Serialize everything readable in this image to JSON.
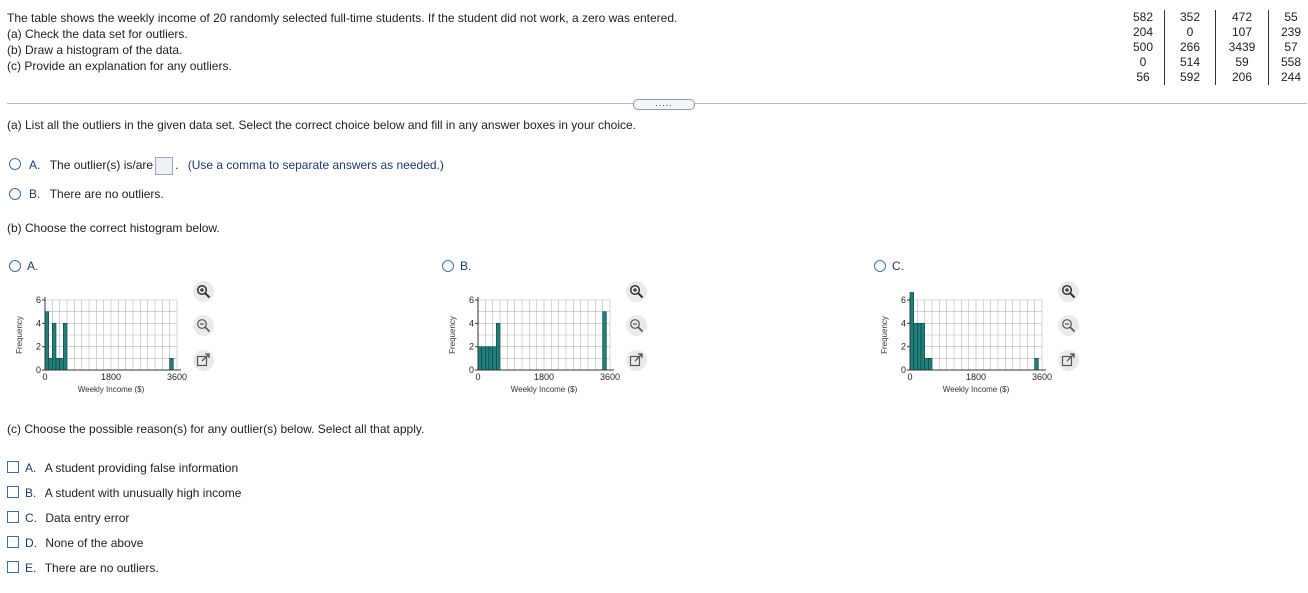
{
  "intro": {
    "line1": "The table shows the weekly income of 20 randomly selected full-time students. If the student did not work, a zero was entered.",
    "line2": "(a) Check the data set for outliers.",
    "line3": "(b) Draw a histogram of the data.",
    "line4": "(c) Provide an explanation for any outliers."
  },
  "data_table": {
    "rows": [
      [
        "582",
        "352",
        "472",
        "55"
      ],
      [
        "204",
        "0",
        "107",
        "239"
      ],
      [
        "500",
        "266",
        "3439",
        "57"
      ],
      [
        "0",
        "514",
        "59",
        "558"
      ],
      [
        "56",
        "592",
        "206",
        "244"
      ]
    ]
  },
  "more_button": {
    "label": "....."
  },
  "part_a": {
    "question": "(a) List all the outliers in the given data set. Select the correct choice below and fill in any answer boxes in your choice.",
    "option_a_letter": "A.",
    "option_a_text": "The outlier(s) is/are",
    "option_a_suffix": ".",
    "option_a_hint": "(Use a comma to separate answers as needed.)",
    "option_b_letter": "B.",
    "option_b_text": "There are no outliers."
  },
  "part_b": {
    "question": "(b) Choose the correct histogram below.",
    "options": [
      {
        "letter": "A."
      },
      {
        "letter": "B."
      },
      {
        "letter": "C."
      }
    ],
    "histogram": {
      "ylabel": "Frequency",
      "xlabel": "Weekly Income ($)",
      "xticks": [
        "0",
        "1800",
        "3600"
      ],
      "yticks": [
        "0",
        "2",
        "4",
        "6"
      ]
    }
  },
  "chart_data": [
    {
      "type": "bar",
      "title": "",
      "xlabel": "Weekly Income ($)",
      "ylabel": "Frequency",
      "xlim": [
        0,
        3600
      ],
      "ylim": [
        0,
        6
      ],
      "bin_width": 100,
      "bin_starts": [
        0,
        100,
        200,
        300,
        400,
        500,
        3400
      ],
      "values": [
        5,
        1,
        4,
        1,
        1,
        4,
        1
      ],
      "grid": true
    },
    {
      "type": "bar",
      "title": "",
      "xlabel": "Weekly Income ($)",
      "ylabel": "Frequency",
      "xlim": [
        0,
        3600
      ],
      "ylim": [
        0,
        6
      ],
      "bin_width": 100,
      "bin_starts": [
        0,
        100,
        200,
        300,
        400,
        500,
        3400
      ],
      "values": [
        2,
        2,
        2,
        2,
        2,
        4,
        5
      ],
      "grid": true
    },
    {
      "type": "bar",
      "title": "",
      "xlabel": "Weekly Income ($)",
      "ylabel": "Frequency",
      "xlim": [
        0,
        3600
      ],
      "ylim": [
        0,
        6
      ],
      "bin_width": 100,
      "bin_starts": [
        0,
        100,
        200,
        300,
        400,
        500,
        3400
      ],
      "values": [
        7,
        4,
        4,
        4,
        1,
        1,
        1
      ],
      "grid": true
    }
  ],
  "part_c": {
    "question": "(c) Choose the possible reason(s) for any outlier(s) below. Select all that apply.",
    "options": [
      {
        "letter": "A.",
        "text": "A student providing false information"
      },
      {
        "letter": "B.",
        "text": "A student with unusually high income"
      },
      {
        "letter": "C.",
        "text": "Data entry error"
      },
      {
        "letter": "D.",
        "text": "None of the above"
      },
      {
        "letter": "E.",
        "text": "There are no outliers."
      }
    ]
  },
  "colors": {
    "bar": "#1f7f7a",
    "link": "#1b3a73",
    "radio_border": "#3d6ea8"
  },
  "icons": [
    "zoom-in-icon",
    "zoom-out-icon",
    "open-external-icon"
  ]
}
